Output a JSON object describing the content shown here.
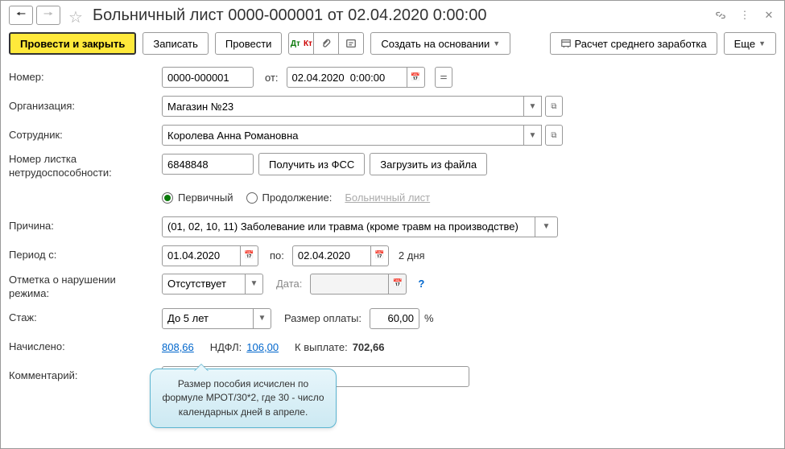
{
  "header": {
    "title": "Больничный лист 0000-000001 от 02.04.2020 0:00:00"
  },
  "toolbar": {
    "post_close": "Провести и закрыть",
    "save": "Записать",
    "post": "Провести",
    "create_basis": "Создать на основании",
    "avg_calc": "Расчет среднего заработка",
    "more": "Еще"
  },
  "form": {
    "number_label": "Номер:",
    "number": "0000-000001",
    "from_label": "от:",
    "date": "02.04.2020  0:00:00",
    "org_label": "Организация:",
    "org": "Магазин №23",
    "emp_label": "Сотрудник:",
    "emp": "Королева Анна Романовна",
    "sheet_label": "Номер листка нетрудоспособности:",
    "sheet_no": "6848848",
    "get_fss": "Получить из ФСС",
    "load_file": "Загрузить из файла",
    "radio_primary": "Первичный",
    "radio_cont": "Продолжение:",
    "cont_link": "Больничный лист",
    "reason_label": "Причина:",
    "reason": "(01, 02, 10, 11) Заболевание или травма (кроме травм на производстве)",
    "period_label": "Период с:",
    "period_from": "01.04.2020",
    "period_to_label": "по:",
    "period_to": "02.04.2020",
    "period_days": "2 дня",
    "violation_label": "Отметка о нарушении режима:",
    "violation": "Отсутствует",
    "violation_date_label": "Дата:",
    "seniority_label": "Стаж:",
    "seniority": "До 5 лет",
    "pay_rate_label": "Размер оплаты:",
    "pay_rate": "60,00",
    "pay_unit": "%",
    "accrued_label": "Начислено:",
    "accrued": "808,66",
    "ndfl_label": "НДФЛ:",
    "ndfl": "106,00",
    "payout_label": "К выплате:",
    "payout": "702,66",
    "comment_label": "Комментарий:"
  },
  "callout": "Размер пособия исчислен по формуле МРОТ/30*2, где 30 - число календарных дней в апреле."
}
